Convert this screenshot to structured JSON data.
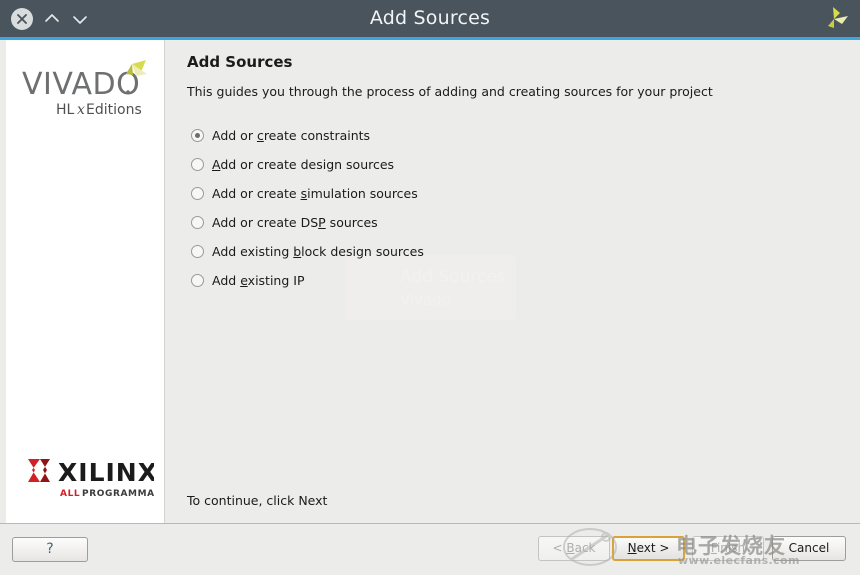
{
  "window": {
    "title": "Add Sources",
    "close_icon": "close-circle-icon",
    "collapse_icon": "chevron-up-icon",
    "expand_icon": "chevron-down-icon",
    "brand_icon": "xilinx-pinwheel-icon"
  },
  "sidebar": {
    "product_name": "VIVADO",
    "product_edition": "HLx Editions",
    "vendor_name": "XILINX",
    "vendor_tagline": "ALL PROGRAMMABLE",
    "vendor_logo_icon": "xilinx-x-icon",
    "product_logo_icon": "vivado-pinwheel-icon"
  },
  "content": {
    "heading": "Add Sources",
    "description": "This guides you through the process of adding and creating sources for your project",
    "footer_note": "To continue, click Next",
    "options": [
      {
        "id": "constraints",
        "before": "Add or ",
        "mnemonic": "c",
        "after": "reate constraints",
        "selected": true
      },
      {
        "id": "design",
        "before": "",
        "mnemonic": "A",
        "after": "dd or create design sources",
        "selected": false
      },
      {
        "id": "simulation",
        "before": "Add or create ",
        "mnemonic": "s",
        "after": "imulation sources",
        "selected": false
      },
      {
        "id": "dsp",
        "before": "Add or create DS",
        "mnemonic": "P",
        "after": " sources",
        "selected": false
      },
      {
        "id": "block-design",
        "before": "Add existing ",
        "mnemonic": "b",
        "after": "lock design sources",
        "selected": false
      },
      {
        "id": "existing-ip",
        "before": "Add ",
        "mnemonic": "e",
        "after": "xisting IP",
        "selected": false
      }
    ],
    "ghost_line1": "Add Sources",
    "ghost_line2": "Vivado"
  },
  "buttons": {
    "help": "?",
    "back": "< Back",
    "next": "Next >",
    "next_before": "",
    "next_mnemonic": "N",
    "next_after": "ext >",
    "back_before": "< ",
    "back_mnemonic": "B",
    "back_after": "ack",
    "finish_before": "",
    "finish_mnemonic": "F",
    "finish_after": "inish",
    "finish": "Finish",
    "cancel": "Cancel"
  },
  "watermark": {
    "text_cn": "电子发烧友",
    "url": "www.elecfans.com"
  },
  "colors": {
    "titlebar": "#4a545c",
    "accent_blue": "#3ba8dd",
    "panel_bg": "#ececeb",
    "sidebar_bg": "#ffffff",
    "focus_border": "#d7a33a",
    "xilinx_red": "#d31f26",
    "vivado_green": "#cfd44a"
  }
}
